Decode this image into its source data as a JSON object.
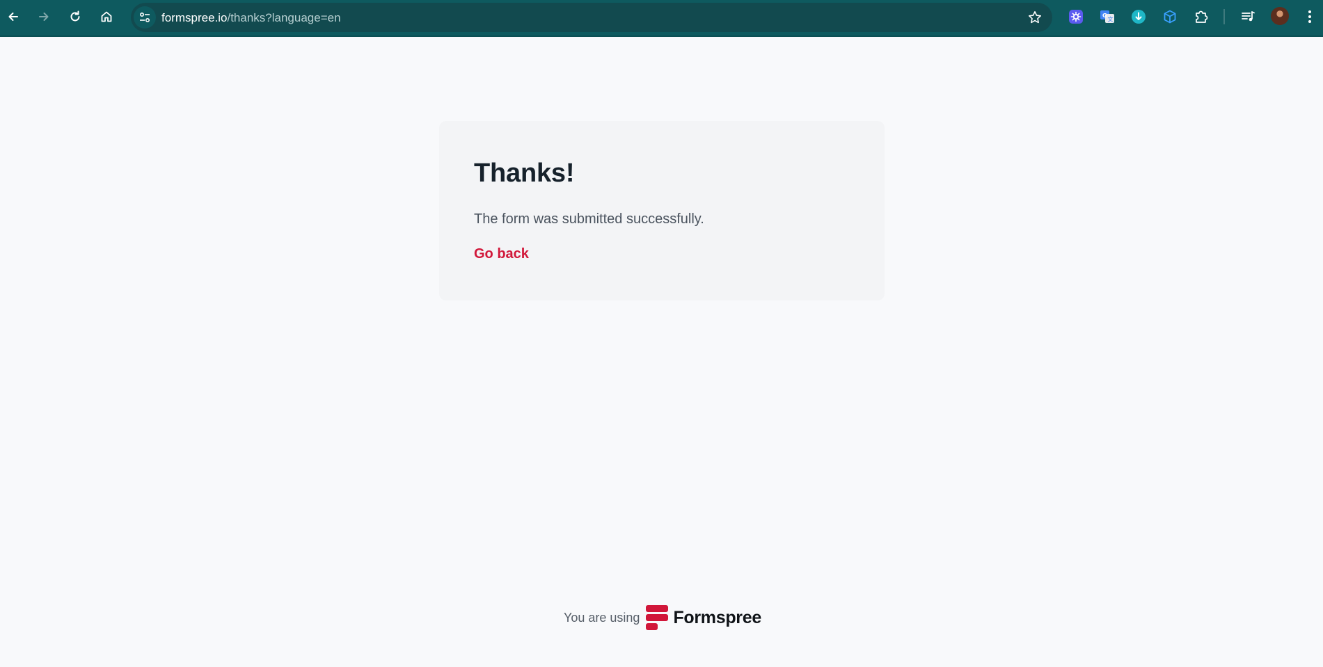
{
  "browser": {
    "url_host": "formspree.io",
    "url_path": "/thanks?language=en",
    "toolbar_color": "#0e5a5f",
    "extension_icons": [
      "settings-gear-extension",
      "google-translate-extension",
      "download-extension",
      "cube-extension",
      "puzzle-extensions"
    ]
  },
  "card": {
    "title": "Thanks!",
    "message": "The form was submitted successfully.",
    "link_label": "Go back",
    "link_color": "#d1173a"
  },
  "footer": {
    "prefix": "You are using",
    "brand": "Formspree",
    "brand_color": "#d1173a"
  }
}
